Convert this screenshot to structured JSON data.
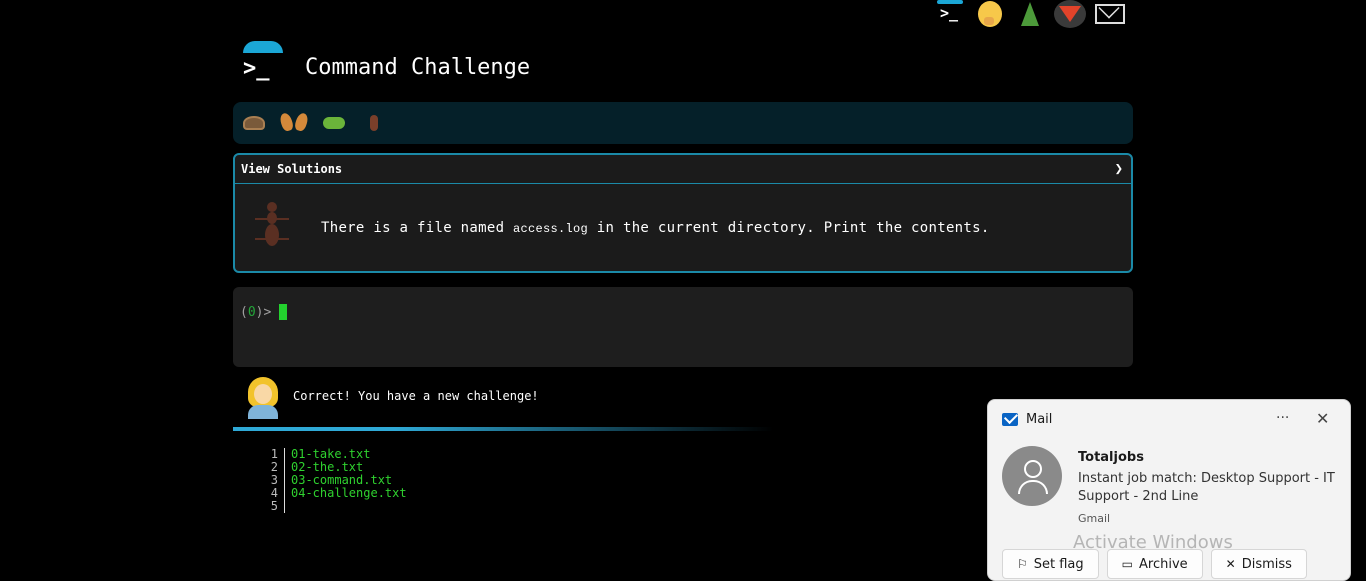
{
  "header": {
    "title": "Command Challenge",
    "logo_glyph": ">_"
  },
  "topbar": {
    "icons": [
      "terminal-icon",
      "shushing-face-icon",
      "tree-icon",
      "gitlab-icon",
      "mail-icon"
    ],
    "terminal_glyph": ">_"
  },
  "levels": {
    "icons": [
      "snail-icon",
      "butterfly-icon",
      "caterpillar-icon",
      "ant-icon"
    ]
  },
  "challenge": {
    "view_solutions_label": "View Solutions",
    "chevron": "❯",
    "text_before": "There is a file named ",
    "file_name": "access.log",
    "text_after": " in the current directory. Print the contents."
  },
  "terminal": {
    "prompt_open": "(",
    "prompt_count": "0",
    "prompt_close": ")>"
  },
  "feedback": {
    "message": "Correct! You have a new challenge!"
  },
  "files": [
    {
      "num": "1",
      "name": "01-take.txt"
    },
    {
      "num": "2",
      "name": "02-the.txt"
    },
    {
      "num": "3",
      "name": "03-command.txt"
    },
    {
      "num": "4",
      "name": "04-challenge.txt"
    },
    {
      "num": "5",
      "name": ""
    }
  ],
  "notification": {
    "app": "Mail",
    "more": "···",
    "close": "✕",
    "sender": "Totaljobs",
    "subject": "Instant job match: Desktop Support - IT Support - 2nd Line",
    "account": "Gmail",
    "watermark": "Activate Windows",
    "actions": {
      "set_flag": "Set flag",
      "archive": "Archive",
      "dismiss": "Dismiss"
    }
  },
  "colors": {
    "accent": "#1ba7d6",
    "panel_border": "#1b8aa8",
    "cursor": "#23d12e",
    "file_green": "#2fd12f"
  }
}
